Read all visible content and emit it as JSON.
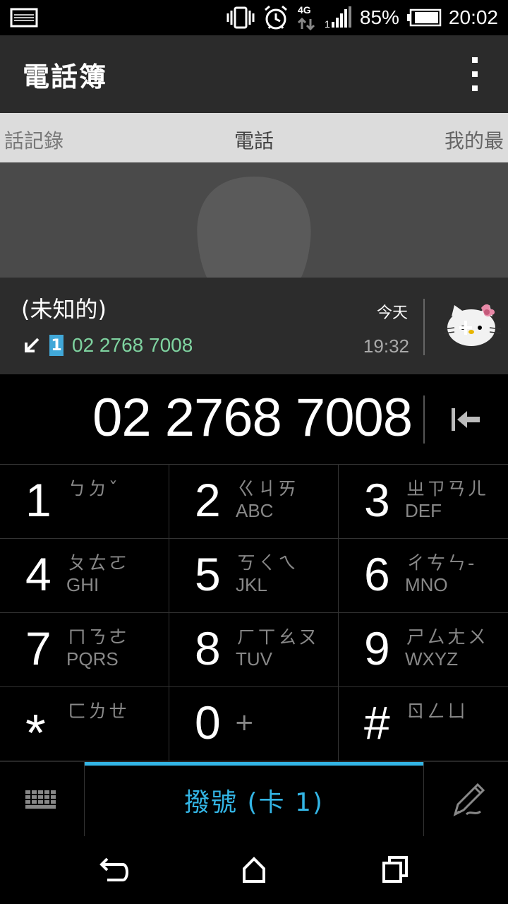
{
  "status_bar": {
    "battery_percent": "85%",
    "time": "20:02",
    "network": "4G",
    "sim_slot": "1",
    "icons": [
      "image-icon",
      "vibrate-icon",
      "alarm-icon",
      "data-transfer-icon",
      "signal-icon",
      "battery-icon"
    ]
  },
  "app_bar": {
    "title": "電話簿",
    "menu_icon": "overflow-menu-icon"
  },
  "tabs": {
    "left": "話記錄",
    "center": "電話",
    "right": "我的最"
  },
  "recent_call": {
    "name": "(未知的)",
    "number": "02 2768 7008",
    "sim": "1",
    "day": "今天",
    "time": "19:32",
    "direction_icon": "incoming-call-arrow-icon",
    "add_contact_icon": "add-contact-icon"
  },
  "dialer": {
    "number": "02 2768 7008",
    "backspace_icon": "backspace-icon"
  },
  "keypad": [
    {
      "digit": "1",
      "zhuyin": "ㄅㄉˇ",
      "latin": ""
    },
    {
      "digit": "2",
      "zhuyin": "ㄍㄐㄞ",
      "latin": "ABC"
    },
    {
      "digit": "3",
      "zhuyin": "ㄓㄗㄢㄦ",
      "latin": "DEF"
    },
    {
      "digit": "4",
      "zhuyin": "ㄆㄊㄛ",
      "latin": "GHI"
    },
    {
      "digit": "5",
      "zhuyin": "ㄎㄑㄟ",
      "latin": "JKL"
    },
    {
      "digit": "6",
      "zhuyin": "ㄔㄘㄣ-",
      "latin": "MNO"
    },
    {
      "digit": "7",
      "zhuyin": "ㄇㄋㄜ",
      "latin": "PQRS"
    },
    {
      "digit": "8",
      "zhuyin": "ㄏㄒㄠㄡ",
      "latin": "TUV"
    },
    {
      "digit": "9",
      "zhuyin": "ㄕㄙㄤㄨ",
      "latin": "WXYZ"
    },
    {
      "digit": "*",
      "zhuyin": "ㄈㄌㄝ",
      "latin": ""
    },
    {
      "digit": "0",
      "zhuyin": "",
      "latin": "",
      "plus": "+"
    },
    {
      "digit": "#",
      "zhuyin": "ㄖㄥㄩ",
      "latin": ""
    }
  ],
  "action_bar": {
    "call_label": "撥號 (卡 1)",
    "keyboard_icon": "keyboard-icon",
    "pen_icon": "pen-icon"
  },
  "nav_bar": {
    "icons": [
      "back-icon",
      "home-icon",
      "recent-apps-icon"
    ]
  }
}
